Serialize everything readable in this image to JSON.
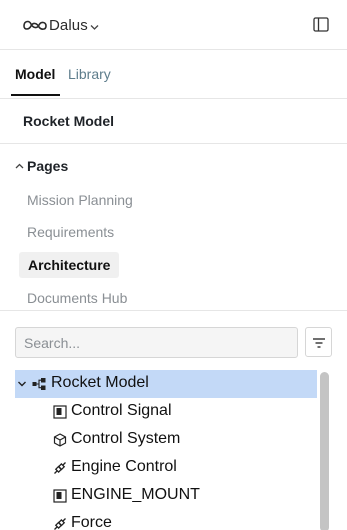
{
  "brand": {
    "name": "Dalus"
  },
  "tabs": [
    {
      "label": "Model"
    },
    {
      "label": "Library"
    }
  ],
  "model": {
    "title": "Rocket Model"
  },
  "pages": {
    "header": "Pages",
    "items": [
      {
        "label": "Mission Planning"
      },
      {
        "label": "Requirements"
      },
      {
        "label": "Architecture"
      },
      {
        "label": "Documents Hub"
      }
    ],
    "active": "Architecture"
  },
  "search": {
    "placeholder": "Search...",
    "value": ""
  },
  "tree": {
    "root": {
      "label": "Rocket Model",
      "icon": "hierarchy-icon",
      "expanded": true
    },
    "children": [
      {
        "label": "Control Signal",
        "icon": "signal-block-icon"
      },
      {
        "label": "Control System",
        "icon": "cube-icon"
      },
      {
        "label": "Engine Control",
        "icon": "link-icon"
      },
      {
        "label": "ENGINE_MOUNT",
        "icon": "signal-block-icon"
      },
      {
        "label": "Force",
        "icon": "link-icon"
      }
    ]
  },
  "colors": {
    "selected_row": "#c3d9f7",
    "muted_text": "#8a8f94",
    "tab_inactive": "#5e7d8c"
  }
}
